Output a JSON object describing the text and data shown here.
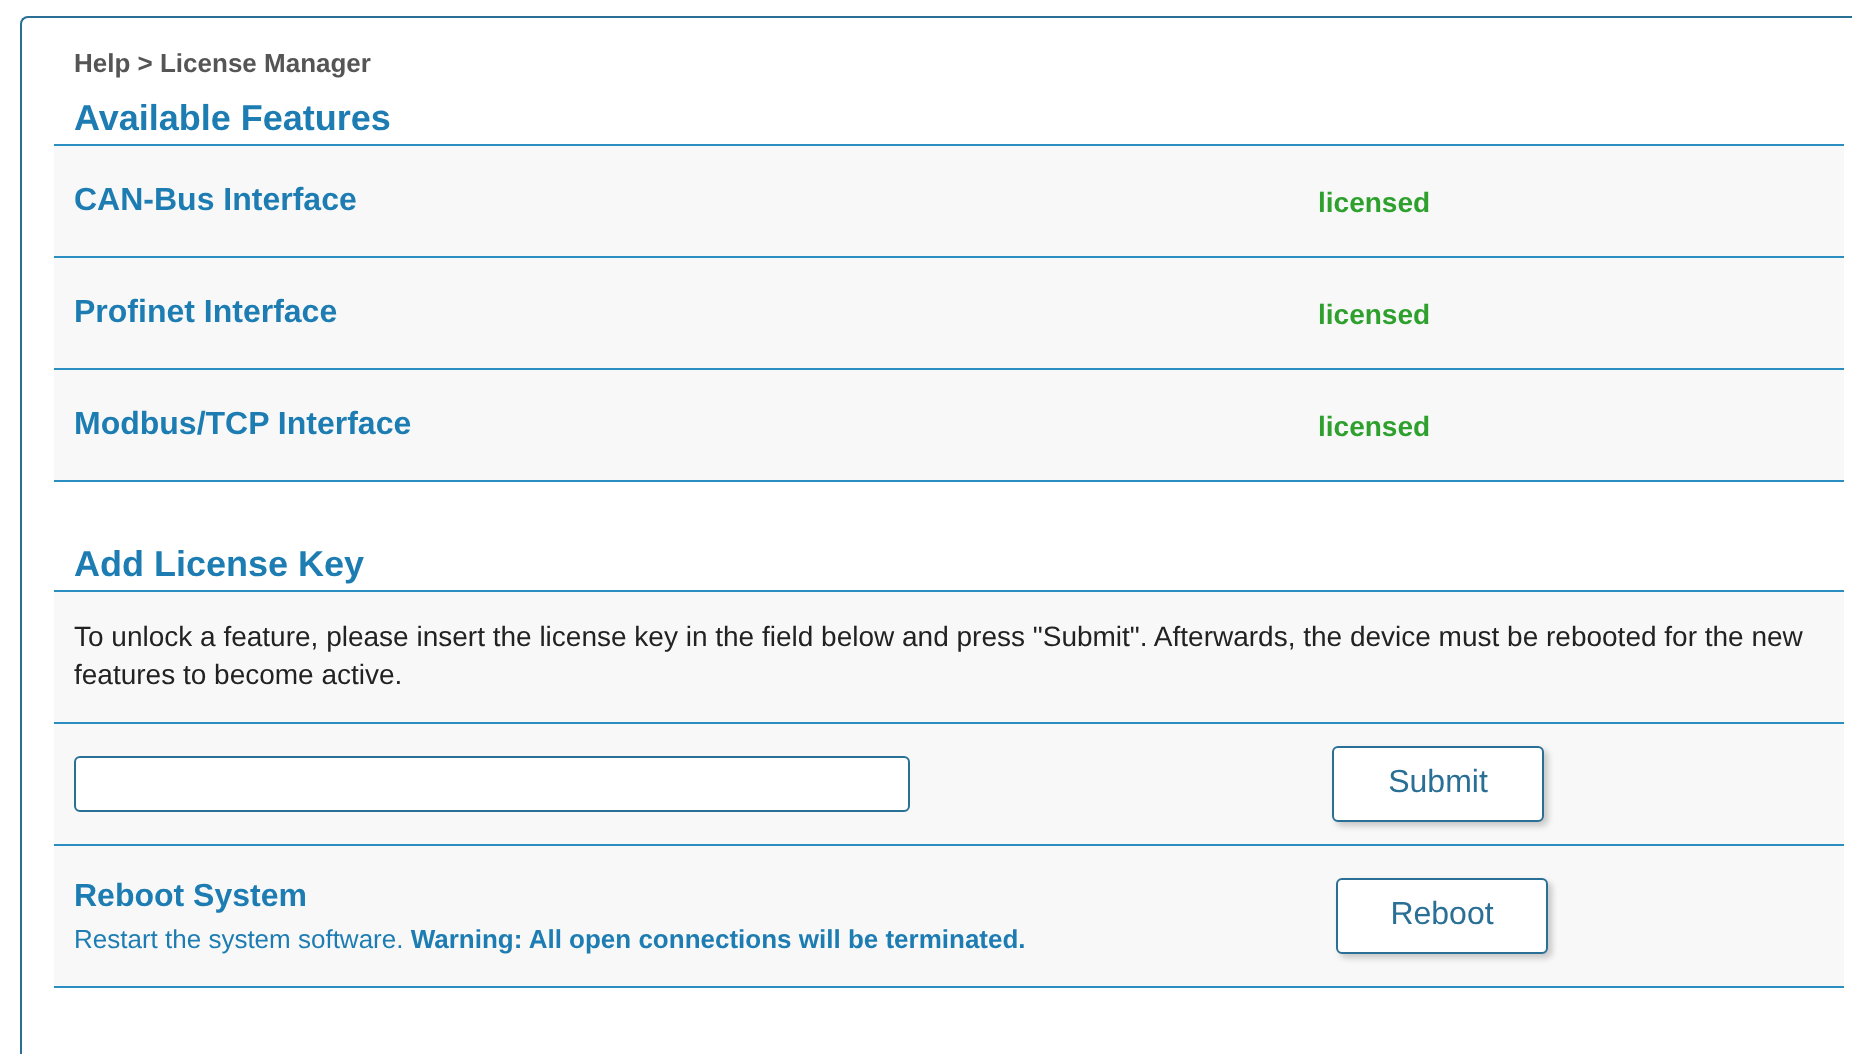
{
  "breadcrumb": "Help > License Manager",
  "features": {
    "title": "Available Features",
    "items": [
      {
        "name": "CAN-Bus Interface",
        "status": "licensed"
      },
      {
        "name": "Profinet Interface",
        "status": "licensed"
      },
      {
        "name": "Modbus/TCP Interface",
        "status": "licensed"
      }
    ]
  },
  "license": {
    "title": "Add License Key",
    "description": "To unlock a feature, please insert the license key in the field below and press \"Submit\". Afterwards, the device must be rebooted for the new features to become active.",
    "submit": "Submit"
  },
  "reboot": {
    "title": "Reboot System",
    "description": "Restart the system software. **Warning: All open connections will be terminated.**",
    "button": "Reboot"
  }
}
